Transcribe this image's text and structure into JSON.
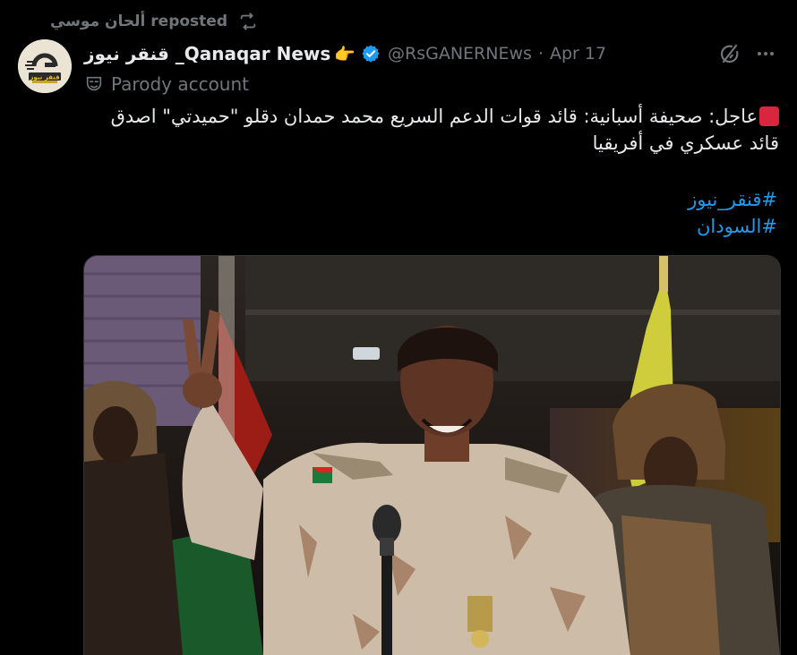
{
  "repost": {
    "label": "ألحان موسي reposted",
    "icon": "repost-icon"
  },
  "author": {
    "avatar_text": "قنقر نيوز",
    "name": "قنقر نيوز _Qanaqar News",
    "emoji": "👉",
    "verified_icon": "verified-badge-icon",
    "handle": "@RsGANERNEws",
    "date": "Apr 17",
    "parody_label": "Parody account",
    "parody_icon": "theater-mask-icon"
  },
  "actions": {
    "grok_icon": "grok-icon",
    "more_icon": "more-icon"
  },
  "post": {
    "line1": "عاجل: صحيفة أسبانية: قائد قوات الدعم السريع محمد حمدان دقلو \"حميدتي\" اصدق",
    "line2": "قائد عسكري في أفريقيا",
    "flag_icon": "red-square-emoji",
    "hashtags": [
      "#قنقر_نيوز",
      "#السودان"
    ]
  },
  "colors": {
    "background": "#000000",
    "text": "#e7e9ea",
    "muted": "#71767b",
    "link": "#1d9bf0",
    "verified": "#1d9bf0"
  }
}
